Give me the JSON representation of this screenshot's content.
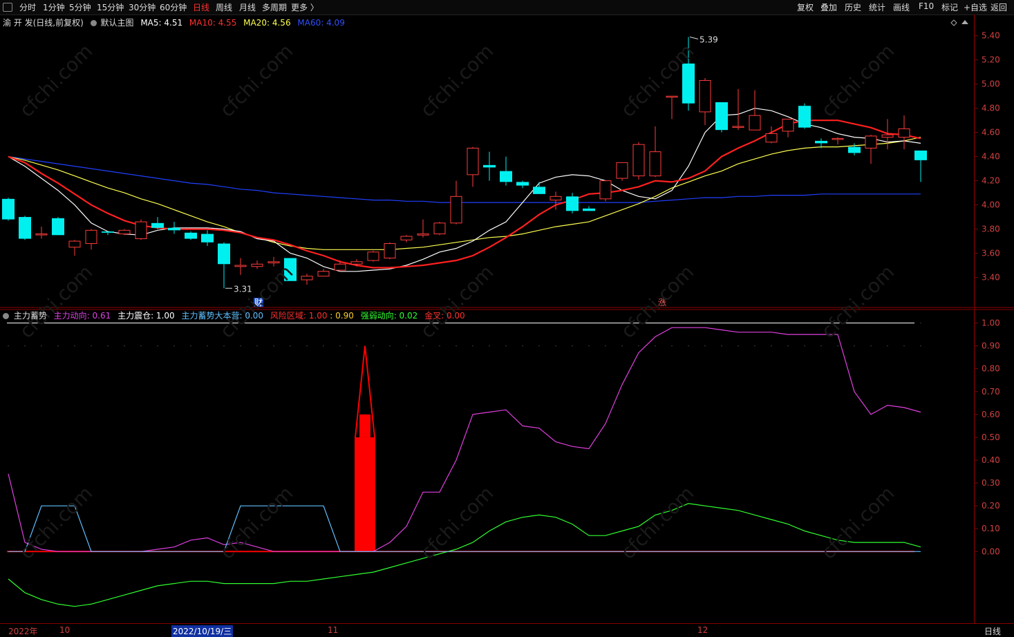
{
  "toolbar": {
    "periods": [
      "分时",
      "1分钟",
      "5分钟",
      "15分钟",
      "30分钟",
      "60分钟",
      "日线",
      "周线",
      "月线",
      "多周期",
      "更多 〉"
    ],
    "active_period": "日线",
    "right_buttons": [
      "复权",
      "叠加",
      "历史",
      "统计",
      "画线",
      "F10",
      "标记",
      "+自选",
      "返回"
    ]
  },
  "main_legend": {
    "title": "渝 开 发(日线,前复权)",
    "template": "默认主图",
    "ma5": "MA5: 4.51",
    "ma10": "MA10: 4.55",
    "ma20": "MA20: 4.56",
    "ma60": "MA60: 4.09"
  },
  "indicator_legend": {
    "name": "主力蓄势",
    "dongxiang": "主力动向: 0.61",
    "zhendang": "主力震仓: 1.00",
    "dabenying": "主力蓄势大本营: 0.00",
    "fengxian": "风险区域: 1.00",
    "fengxian2": ": 0.90",
    "qiangruo": "强弱动向: 0.02",
    "jincha": "金叉: 0.00"
  },
  "annotations": {
    "high": "5.39",
    "low": "3.31",
    "cai": "财",
    "zhang": "涨"
  },
  "bottom": {
    "dates": [
      "2022年",
      "10",
      "2022/10/19/三",
      "11",
      "12"
    ],
    "period": "日线"
  },
  "colors": {
    "up": "#ff3c3c",
    "down": "#00f0f0",
    "ma5": "#ffffff",
    "ma10": "#ff2020",
    "ma20": "#ffff50",
    "ma60": "#2040ff",
    "dongxiang": "#e040e0",
    "qiangruo": "#30ff30",
    "dabenying": "#60c0ff",
    "fengxian": "#ff0000"
  },
  "chart_data": [
    {
      "type": "candlestick",
      "title": "渝 开 发(日线,前复权)",
      "ylim": [
        3.3,
        5.45
      ],
      "y_ticks": [
        "5.40",
        "5.20",
        "5.00",
        "4.80",
        "4.60",
        "4.40",
        "4.20",
        "4.00",
        "3.80",
        "3.60",
        "3.40"
      ],
      "ohlc": [
        [
          4.05,
          4.06,
          3.87,
          3.88
        ],
        [
          3.9,
          3.91,
          3.71,
          3.72
        ],
        [
          3.76,
          3.82,
          3.72,
          3.76
        ],
        [
          3.89,
          3.9,
          3.75,
          3.75
        ],
        [
          3.65,
          3.71,
          3.58,
          3.7
        ],
        [
          3.68,
          3.8,
          3.63,
          3.79
        ],
        [
          3.78,
          3.78,
          3.75,
          3.77
        ],
        [
          3.76,
          3.8,
          3.75,
          3.79
        ],
        [
          3.72,
          3.88,
          3.71,
          3.86
        ],
        [
          3.85,
          3.9,
          3.8,
          3.81
        ],
        [
          3.81,
          3.86,
          3.76,
          3.79
        ],
        [
          3.77,
          3.78,
          3.71,
          3.72
        ],
        [
          3.76,
          3.79,
          3.66,
          3.69
        ],
        [
          3.68,
          3.69,
          3.31,
          3.51
        ],
        [
          3.49,
          3.56,
          3.42,
          3.5
        ],
        [
          3.49,
          3.54,
          3.47,
          3.51
        ],
        [
          3.52,
          3.57,
          3.49,
          3.53
        ],
        [
          3.56,
          3.56,
          3.37,
          3.37
        ],
        [
          3.38,
          3.43,
          3.34,
          3.41
        ],
        [
          3.41,
          3.47,
          3.41,
          3.45
        ],
        [
          3.46,
          3.54,
          3.45,
          3.51
        ],
        [
          3.51,
          3.55,
          3.49,
          3.53
        ],
        [
          3.54,
          3.62,
          3.53,
          3.61
        ],
        [
          3.56,
          3.69,
          3.55,
          3.68
        ],
        [
          3.71,
          3.75,
          3.69,
          3.74
        ],
        [
          3.75,
          3.88,
          3.73,
          3.76
        ],
        [
          3.76,
          3.86,
          3.75,
          3.85
        ],
        [
          3.85,
          4.2,
          3.84,
          4.07
        ],
        [
          4.25,
          4.48,
          4.15,
          4.47
        ],
        [
          4.33,
          4.44,
          4.2,
          4.31
        ],
        [
          4.28,
          4.4,
          4.16,
          4.19
        ],
        [
          4.19,
          4.2,
          4.14,
          4.16
        ],
        [
          4.15,
          4.19,
          4.09,
          4.09
        ],
        [
          4.04,
          4.11,
          3.96,
          4.07
        ],
        [
          4.07,
          4.1,
          3.93,
          3.95
        ],
        [
          3.97,
          3.99,
          3.95,
          3.95
        ],
        [
          4.05,
          4.1,
          4.03,
          4.2
        ],
        [
          4.22,
          4.35,
          4.2,
          4.35
        ],
        [
          4.24,
          4.52,
          4.21,
          4.5
        ],
        [
          4.24,
          4.65,
          4.23,
          4.44
        ],
        [
          4.9,
          4.9,
          4.71,
          4.9
        ],
        [
          5.17,
          5.39,
          4.78,
          4.84
        ],
        [
          4.77,
          5.05,
          4.66,
          5.03
        ],
        [
          4.85,
          4.85,
          4.6,
          4.62
        ],
        [
          4.65,
          4.96,
          4.62,
          4.65
        ],
        [
          4.62,
          4.95,
          4.62,
          4.74
        ],
        [
          4.52,
          4.65,
          4.51,
          4.59
        ],
        [
          4.61,
          4.71,
          4.56,
          4.71
        ],
        [
          4.82,
          4.84,
          4.63,
          4.64
        ],
        [
          4.53,
          4.55,
          4.47,
          4.51
        ],
        [
          4.55,
          4.56,
          4.5,
          4.55
        ],
        [
          4.48,
          4.51,
          4.41,
          4.43
        ],
        [
          4.47,
          4.58,
          4.34,
          4.57
        ],
        [
          4.56,
          4.71,
          4.46,
          4.58
        ],
        [
          4.56,
          4.74,
          4.46,
          4.63
        ],
        [
          4.45,
          4.45,
          4.19,
          4.37
        ]
      ],
      "ma5": [
        4.4,
        4.32,
        4.22,
        4.12,
        4.0,
        3.85,
        3.78,
        3.76,
        3.75,
        3.79,
        3.81,
        3.81,
        3.81,
        3.8,
        3.78,
        3.72,
        3.7,
        3.6,
        3.56,
        3.49,
        3.45,
        3.45,
        3.46,
        3.47,
        3.5,
        3.55,
        3.61,
        3.64,
        3.7,
        3.79,
        3.86,
        4.02,
        4.18,
        4.23,
        4.25,
        4.24,
        4.2,
        4.12,
        4.07,
        4.05,
        4.12,
        4.32,
        4.6,
        4.74,
        4.75,
        4.8,
        4.78,
        4.73,
        4.67,
        4.64,
        4.59,
        4.56,
        4.55,
        4.52,
        4.53,
        4.51
      ],
      "ma10": [
        4.4,
        4.35,
        4.26,
        4.18,
        4.09,
        4.0,
        3.93,
        3.87,
        3.83,
        3.81,
        3.8,
        3.8,
        3.8,
        3.79,
        3.77,
        3.73,
        3.71,
        3.67,
        3.62,
        3.58,
        3.53,
        3.5,
        3.48,
        3.48,
        3.49,
        3.5,
        3.52,
        3.54,
        3.58,
        3.65,
        3.73,
        3.82,
        3.92,
        4.0,
        4.04,
        4.09,
        4.1,
        4.12,
        4.15,
        4.2,
        4.19,
        4.22,
        4.28,
        4.4,
        4.47,
        4.53,
        4.6,
        4.67,
        4.7,
        4.7,
        4.7,
        4.67,
        4.64,
        4.59,
        4.58,
        4.55
      ],
      "ma20": [
        4.4,
        4.37,
        4.33,
        4.29,
        4.24,
        4.19,
        4.14,
        4.1,
        4.05,
        4.01,
        3.96,
        3.91,
        3.86,
        3.82,
        3.77,
        3.73,
        3.69,
        3.66,
        3.64,
        3.63,
        3.63,
        3.63,
        3.63,
        3.63,
        3.64,
        3.65,
        3.67,
        3.69,
        3.71,
        3.73,
        3.74,
        3.76,
        3.79,
        3.82,
        3.84,
        3.86,
        3.91,
        3.96,
        4.01,
        4.07,
        4.14,
        4.19,
        4.24,
        4.28,
        4.34,
        4.38,
        4.42,
        4.45,
        4.47,
        4.48,
        4.48,
        4.49,
        4.5,
        4.51,
        4.53,
        4.56
      ],
      "ma60": [
        4.4,
        4.38,
        4.36,
        4.34,
        4.32,
        4.3,
        4.28,
        4.26,
        4.24,
        4.22,
        4.2,
        4.18,
        4.17,
        4.15,
        4.13,
        4.12,
        4.1,
        4.09,
        4.08,
        4.07,
        4.06,
        4.05,
        4.04,
        4.04,
        4.03,
        4.03,
        4.02,
        4.02,
        4.02,
        4.02,
        4.02,
        4.02,
        4.02,
        4.02,
        4.02,
        4.02,
        4.02,
        4.02,
        4.02,
        4.03,
        4.04,
        4.05,
        4.06,
        4.06,
        4.07,
        4.07,
        4.08,
        4.08,
        4.08,
        4.09,
        4.09,
        4.09,
        4.09,
        4.09,
        4.09,
        4.09
      ]
    },
    {
      "type": "line",
      "title": "主力蓄势",
      "ylim": [
        -0.25,
        1.05
      ],
      "y_ticks": [
        "1.00",
        "0.90",
        "0.80",
        "0.70",
        "0.60",
        "0.50",
        "0.40",
        "0.30",
        "0.20",
        "0.10",
        "0.00"
      ],
      "series": [
        {
          "name": "主力动向",
          "values": [
            0.34,
            0.04,
            0.01,
            0,
            0,
            0,
            0,
            0,
            0,
            0.01,
            0.02,
            0.05,
            0.06,
            0.03,
            0.04,
            0.02,
            0,
            0,
            0,
            0,
            0,
            0,
            0,
            0.04,
            0.11,
            0.26,
            0.26,
            0.4,
            0.6,
            0.61,
            0.62,
            0.55,
            0.54,
            0.48,
            0.46,
            0.45,
            0.56,
            0.73,
            0.87,
            0.94,
            0.98,
            0.98,
            0.98,
            0.97,
            0.96,
            0.96,
            0.96,
            0.95,
            0.95,
            0.95,
            0.95,
            0.7,
            0.6,
            0.64,
            0.63,
            0.61
          ]
        },
        {
          "name": "强弱动向",
          "values": [
            -0.12,
            -0.18,
            -0.21,
            -0.23,
            -0.24,
            -0.23,
            -0.21,
            -0.19,
            -0.17,
            -0.15,
            -0.14,
            -0.13,
            -0.13,
            -0.14,
            -0.14,
            -0.14,
            -0.14,
            -0.13,
            -0.13,
            -0.12,
            -0.11,
            -0.1,
            -0.09,
            -0.07,
            -0.05,
            -0.03,
            -0.01,
            0.01,
            0.04,
            0.09,
            0.13,
            0.15,
            0.16,
            0.15,
            0.12,
            0.07,
            0.07,
            0.09,
            0.11,
            0.16,
            0.18,
            0.21,
            0.2,
            0.19,
            0.18,
            0.16,
            0.14,
            0.12,
            0.09,
            0.07,
            0.05,
            0.04,
            0.04,
            0.04,
            0.04,
            0.02
          ]
        },
        {
          "name": "主力蓄势大本营",
          "values": [
            0,
            0,
            0.2,
            0.2,
            0.2,
            0,
            0,
            0,
            0,
            0,
            0,
            0,
            0,
            0,
            0.2,
            0.2,
            0.2,
            0.2,
            0.2,
            0.2,
            0,
            0,
            0,
            0,
            0,
            0,
            0,
            0,
            0,
            0,
            0,
            0,
            0,
            0,
            0,
            0,
            0,
            0,
            0,
            0,
            0,
            0,
            0,
            0,
            0,
            0,
            0,
            0,
            0,
            0,
            0,
            0,
            0,
            0,
            0,
            0
          ]
        }
      ],
      "risk_bars": {
        "name": "风险区域",
        "from_index": 21,
        "to_index": 22,
        "level": 0.5,
        "step": 0.6,
        "peak": 0.9
      }
    }
  ]
}
